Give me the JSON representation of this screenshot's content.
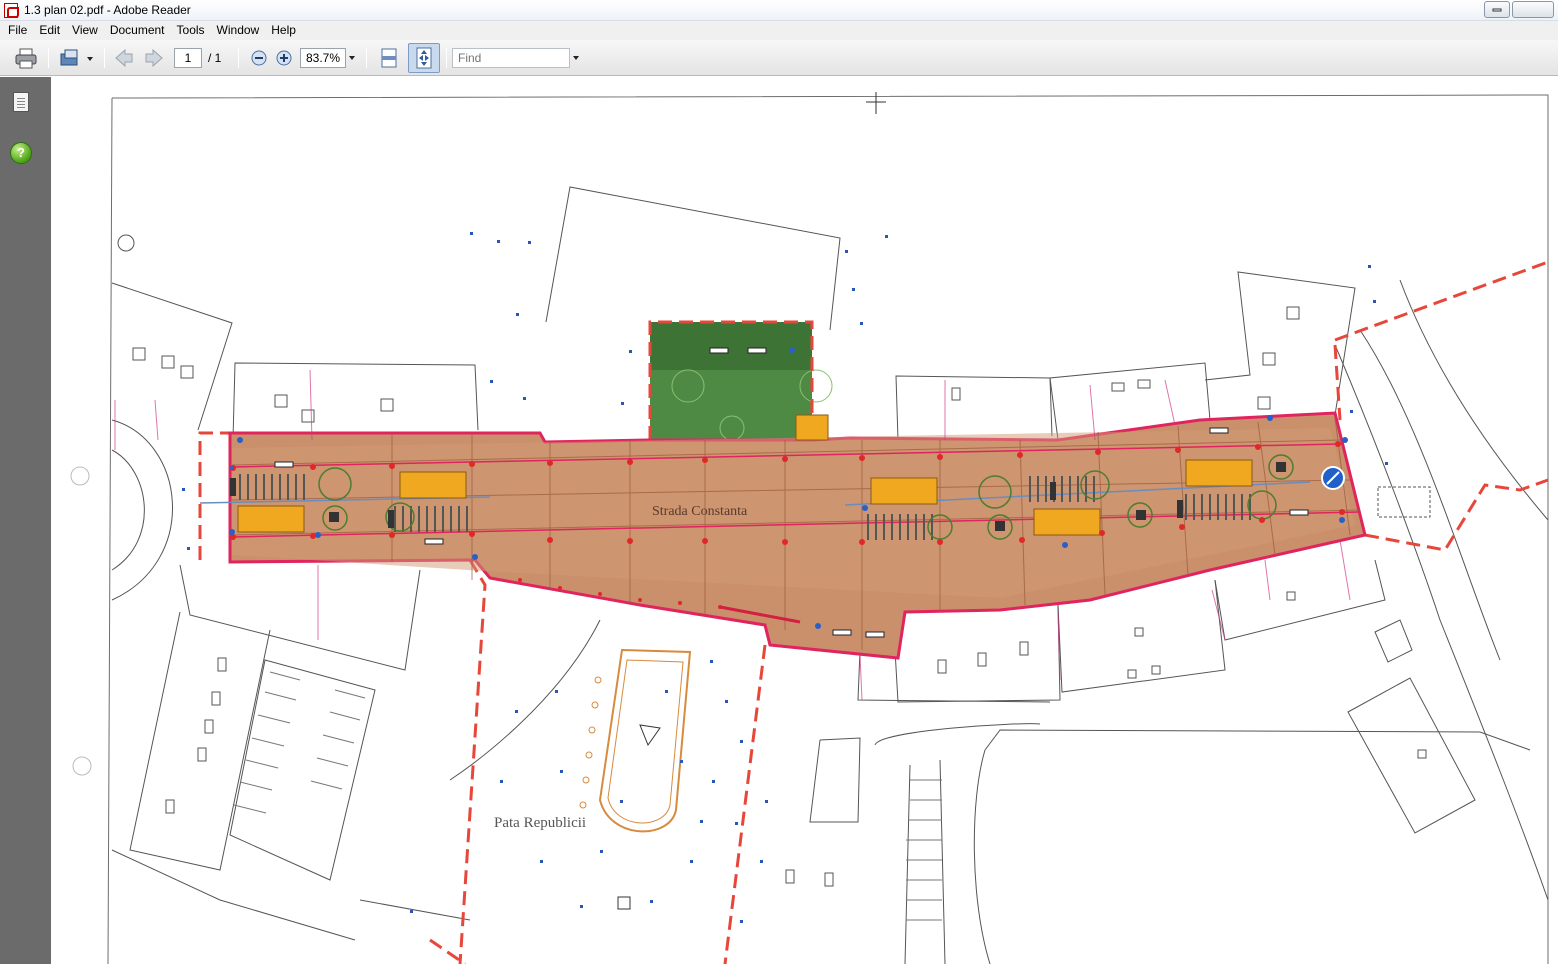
{
  "window": {
    "title": "1.3 plan 02.pdf - Adobe Reader"
  },
  "menu": {
    "items": [
      "File",
      "Edit",
      "View",
      "Document",
      "Tools",
      "Window",
      "Help"
    ]
  },
  "toolbar": {
    "page_current": "1",
    "page_total": "/ 1",
    "zoom": "83.7%",
    "find_placeholder": "Find"
  },
  "document": {
    "street_label": "Strada Constanta",
    "square_label": "Pata Republicii"
  },
  "colors": {
    "street_fill": "#c9906b",
    "street_border": "#e0245e",
    "boundary": "#e6473a",
    "green": "#4f8a45",
    "planter": "#f0a820",
    "nav_pane": "#6b6b6b"
  }
}
